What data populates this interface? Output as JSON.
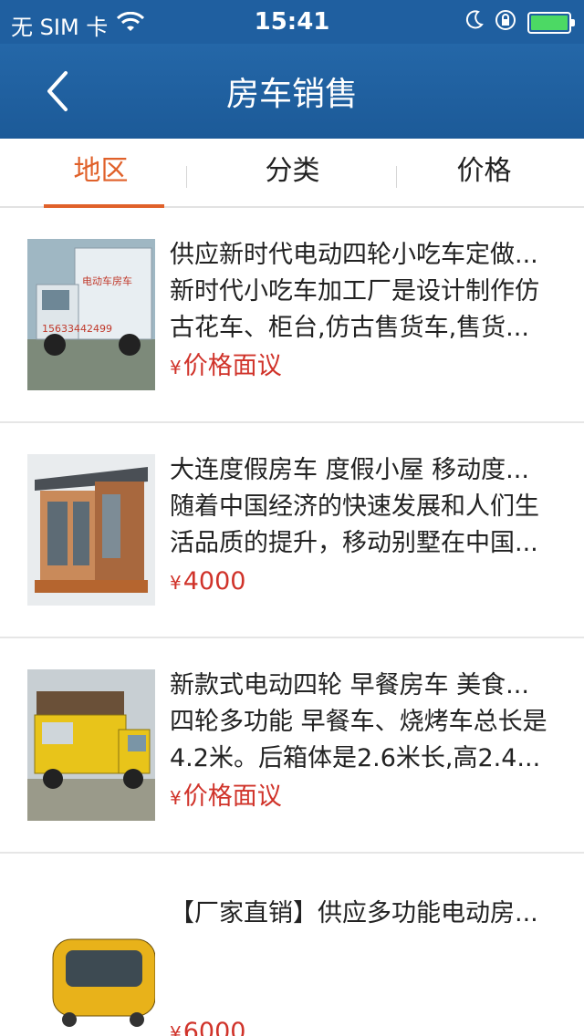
{
  "status_bar": {
    "carrier": "无 SIM 卡",
    "time": "15:41",
    "icons": [
      "wifi-icon",
      "moon-icon",
      "rotation-lock-icon",
      "battery-icon"
    ]
  },
  "nav": {
    "title": "房车销售",
    "back_icon": "chevron-left-icon"
  },
  "tabs": [
    {
      "label": "地区",
      "active": true
    },
    {
      "label": "分类",
      "active": false
    },
    {
      "label": "价格",
      "active": false
    }
  ],
  "currency_symbol": "¥",
  "listings": [
    {
      "title": "供应新时代电动四轮小吃车定做...",
      "desc": "新时代小吃车加工厂是设计制作仿古花车、柜台,仿古售货车,售货...",
      "price": "价格面议"
    },
    {
      "title": "大连度假房车  度假小屋 移动度...",
      "desc": "随着中国经济的快速发展和人们生活品质的提升，移动别墅在中国...",
      "price": "4000"
    },
    {
      "title": "新款式电动四轮 早餐房车 美食...",
      "desc": "四轮多功能 早餐车、烧烤车总长是4.2米。后箱体是2.6米长,高2.4...",
      "price": "价格面议"
    },
    {
      "title": "【厂家直销】供应多功能电动房...",
      "desc": "",
      "price": "6000"
    }
  ],
  "colors": {
    "nav_bg": "#1f5fa0",
    "accent": "#e0612a",
    "price": "#d0332a"
  }
}
